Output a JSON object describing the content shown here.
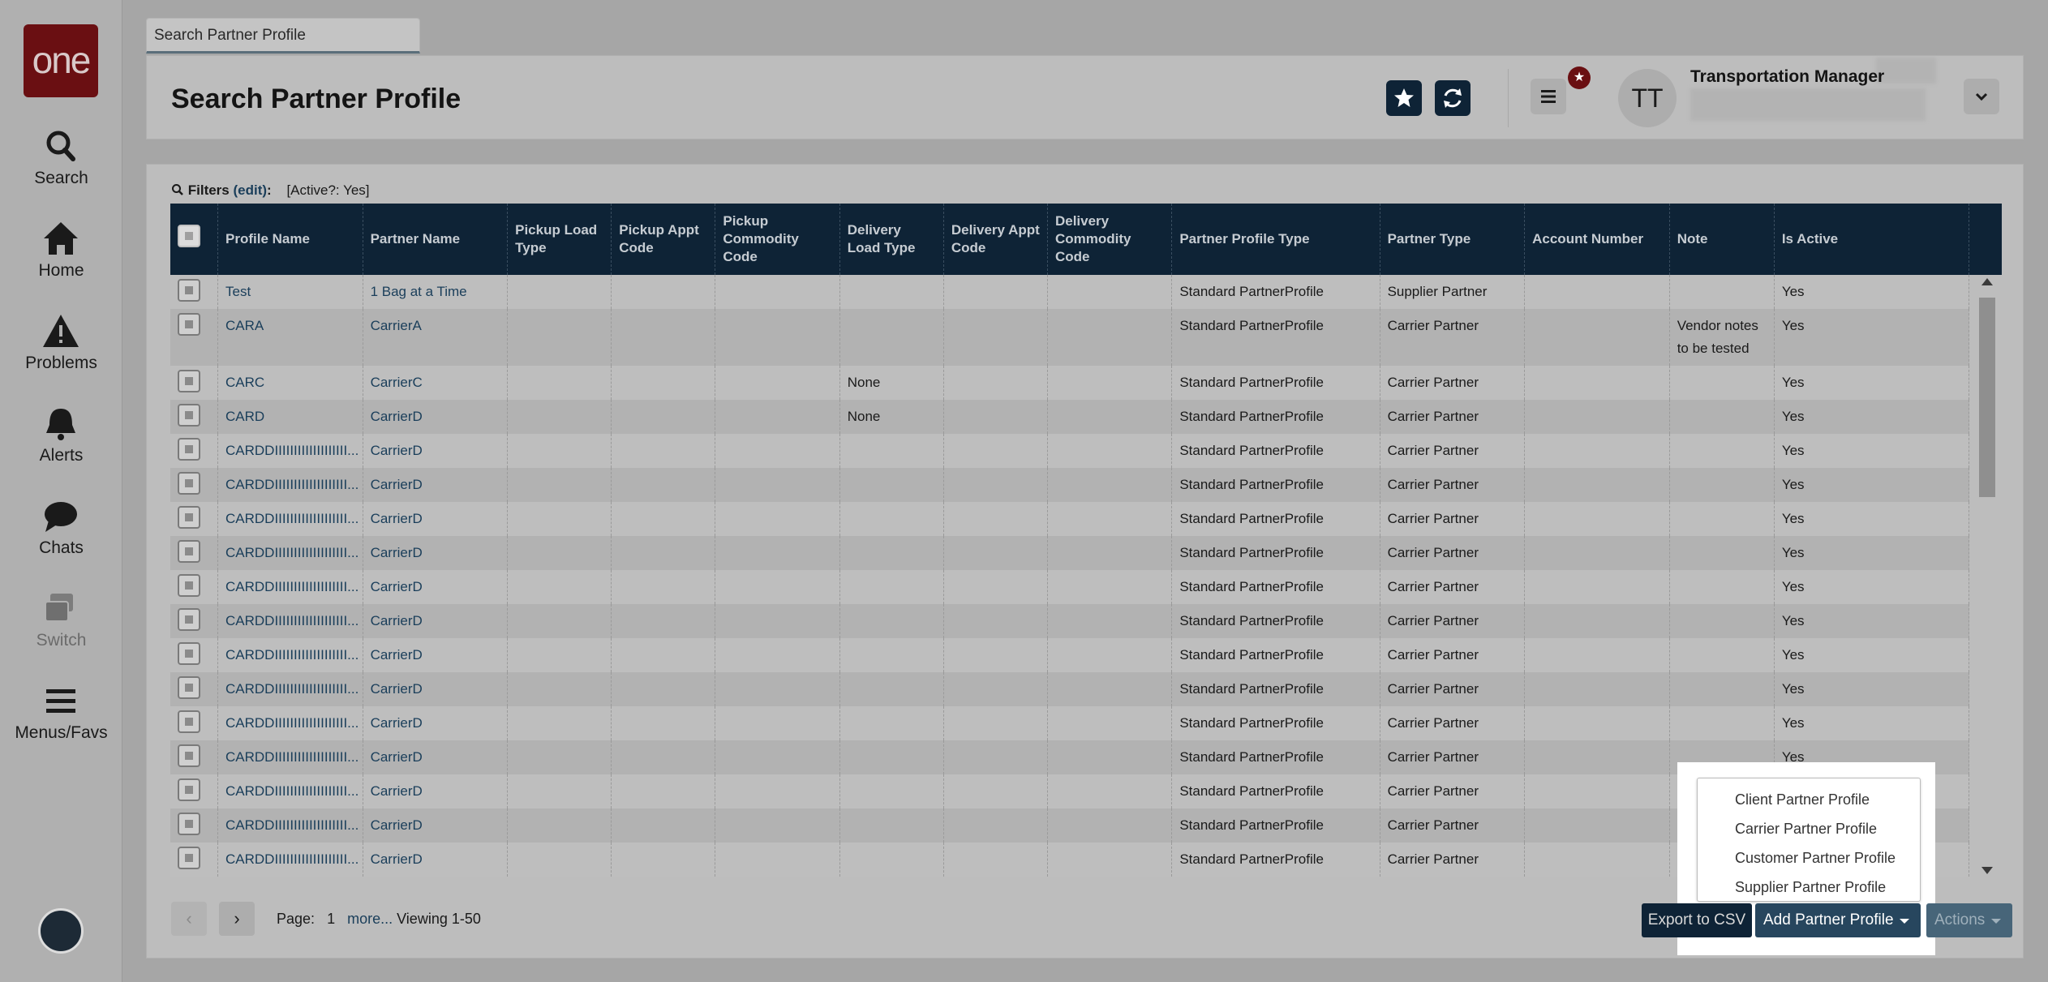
{
  "nav": {
    "logo": "one",
    "items": [
      {
        "label": "Search",
        "icon": "search-icon"
      },
      {
        "label": "Home",
        "icon": "home-icon"
      },
      {
        "label": "Problems",
        "icon": "warning-icon"
      },
      {
        "label": "Alerts",
        "icon": "bell-icon"
      },
      {
        "label": "Chats",
        "icon": "chat-icon"
      },
      {
        "label": "Switch",
        "icon": "switch-icon"
      },
      {
        "label": "Menus/Favs",
        "icon": "hamburger-icon"
      }
    ]
  },
  "tab": {
    "label": "Search Partner Profile"
  },
  "header": {
    "title": "Search Partner Profile",
    "avatar_initials": "TT",
    "user_role": "Transportation Manager",
    "notification_icon": "star-badge-icon"
  },
  "filters": {
    "label": "Filters",
    "edit": "(edit)",
    "value": "[Active?: Yes]"
  },
  "grid": {
    "columns": [
      "Profile Name",
      "Partner Name",
      "Pickup Load Type",
      "Pickup Appt Code",
      "Pickup Commodity Code",
      "Delivery Load Type",
      "Delivery Appt Code",
      "Delivery Commodity Code",
      "Partner Profile Type",
      "Partner Type",
      "Account Number",
      "Note",
      "Is Active"
    ],
    "rows": [
      {
        "profile": "Test",
        "partner": "1 Bag at a Time",
        "delivery_load": "",
        "profile_type": "Standard PartnerProfile",
        "partner_type": "Supplier Partner",
        "note": "",
        "active": "Yes"
      },
      {
        "profile": "CARA",
        "partner": "CarrierA",
        "delivery_load": "",
        "profile_type": "Standard PartnerProfile",
        "partner_type": "Carrier Partner",
        "note": "Vendor notes to be tested",
        "active": "Yes"
      },
      {
        "profile": "CARC",
        "partner": "CarrierC",
        "delivery_load": "None",
        "profile_type": "Standard PartnerProfile",
        "partner_type": "Carrier Partner",
        "note": "",
        "active": "Yes"
      },
      {
        "profile": "CARD",
        "partner": "CarrierD",
        "delivery_load": "None",
        "profile_type": "Standard PartnerProfile",
        "partner_type": "Carrier Partner",
        "note": "",
        "active": "Yes"
      },
      {
        "profile": "CARDDIIIIIIIIIIIIIIIIIII...",
        "partner": "CarrierD",
        "delivery_load": "",
        "profile_type": "Standard PartnerProfile",
        "partner_type": "Carrier Partner",
        "note": "",
        "active": "Yes"
      },
      {
        "profile": "CARDDIIIIIIIIIIIIIIIIIII...",
        "partner": "CarrierD",
        "delivery_load": "",
        "profile_type": "Standard PartnerProfile",
        "partner_type": "Carrier Partner",
        "note": "",
        "active": "Yes"
      },
      {
        "profile": "CARDDIIIIIIIIIIIIIIIIIII...",
        "partner": "CarrierD",
        "delivery_load": "",
        "profile_type": "Standard PartnerProfile",
        "partner_type": "Carrier Partner",
        "note": "",
        "active": "Yes"
      },
      {
        "profile": "CARDDIIIIIIIIIIIIIIIIIII...",
        "partner": "CarrierD",
        "delivery_load": "",
        "profile_type": "Standard PartnerProfile",
        "partner_type": "Carrier Partner",
        "note": "",
        "active": "Yes"
      },
      {
        "profile": "CARDDIIIIIIIIIIIIIIIIIII...",
        "partner": "CarrierD",
        "delivery_load": "",
        "profile_type": "Standard PartnerProfile",
        "partner_type": "Carrier Partner",
        "note": "",
        "active": "Yes"
      },
      {
        "profile": "CARDDIIIIIIIIIIIIIIIIIII...",
        "partner": "CarrierD",
        "delivery_load": "",
        "profile_type": "Standard PartnerProfile",
        "partner_type": "Carrier Partner",
        "note": "",
        "active": "Yes"
      },
      {
        "profile": "CARDDIIIIIIIIIIIIIIIIIII...",
        "partner": "CarrierD",
        "delivery_load": "",
        "profile_type": "Standard PartnerProfile",
        "partner_type": "Carrier Partner",
        "note": "",
        "active": "Yes"
      },
      {
        "profile": "CARDDIIIIIIIIIIIIIIIIIII...",
        "partner": "CarrierD",
        "delivery_load": "",
        "profile_type": "Standard PartnerProfile",
        "partner_type": "Carrier Partner",
        "note": "",
        "active": "Yes"
      },
      {
        "profile": "CARDDIIIIIIIIIIIIIIIIIII...",
        "partner": "CarrierD",
        "delivery_load": "",
        "profile_type": "Standard PartnerProfile",
        "partner_type": "Carrier Partner",
        "note": "",
        "active": "Yes"
      },
      {
        "profile": "CARDDIIIIIIIIIIIIIIIIIII...",
        "partner": "CarrierD",
        "delivery_load": "",
        "profile_type": "Standard PartnerProfile",
        "partner_type": "Carrier Partner",
        "note": "",
        "active": "Yes"
      },
      {
        "profile": "CARDDIIIIIIIIIIIIIIIIIII...",
        "partner": "CarrierD",
        "delivery_load": "",
        "profile_type": "Standard PartnerProfile",
        "partner_type": "Carrier Partner",
        "note": "",
        "active": ""
      },
      {
        "profile": "CARDDIIIIIIIIIIIIIIIIIII...",
        "partner": "CarrierD",
        "delivery_load": "",
        "profile_type": "Standard PartnerProfile",
        "partner_type": "Carrier Partner",
        "note": "",
        "active": ""
      },
      {
        "profile": "CARDDIIIIIIIIIIIIIIIIIII...",
        "partner": "CarrierD",
        "delivery_load": "",
        "profile_type": "Standard PartnerProfile",
        "partner_type": "Carrier Partner",
        "note": "",
        "active": ""
      }
    ]
  },
  "pagination": {
    "prev": "‹",
    "next": "›",
    "page_label": "Page:",
    "page": "1",
    "more": "more...",
    "viewing": "Viewing 1-50"
  },
  "dropdown": {
    "items": [
      "Client Partner Profile",
      "Carrier Partner Profile",
      "Customer Partner Profile",
      "Supplier Partner Profile"
    ]
  },
  "buttons": {
    "export": "Export to CSV",
    "add": "Add Partner Profile",
    "actions": "Actions"
  }
}
